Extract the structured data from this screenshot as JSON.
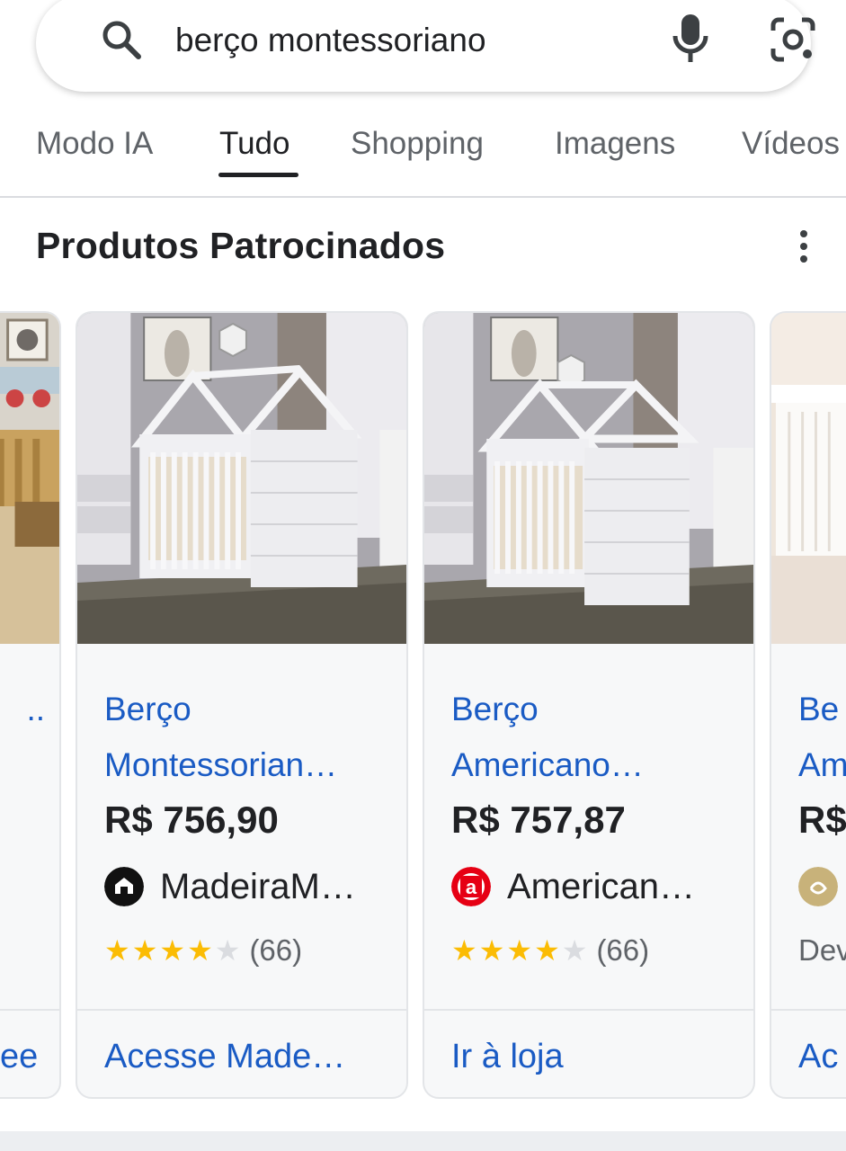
{
  "search": {
    "query": "berço montessoriano",
    "search_icon": "search-icon",
    "mic_icon": "mic-icon",
    "lens_icon": "lens-camera-icon"
  },
  "tabs": [
    {
      "label": "Modo IA",
      "active": false
    },
    {
      "label": "Tudo",
      "active": true
    },
    {
      "label": "Shopping",
      "active": false
    },
    {
      "label": "Imagens",
      "active": false
    },
    {
      "label": "Vídeos",
      "active": false
    }
  ],
  "section": {
    "title": "Produtos Patrocinados",
    "more_icon": "more-vert-icon"
  },
  "products": [
    {
      "title_line1": "",
      "title_line2": "..",
      "price": "",
      "seller": "",
      "rating_stars": 0,
      "rating_count": "",
      "cta": "ee"
    },
    {
      "title_line1": "Berço",
      "title_line2": "Montessorian…",
      "price": "R$ 756,90",
      "seller": "MadeiraM…",
      "seller_logo": "madeiramadeira-logo",
      "rating_stars": 4,
      "rating_count": "(66)",
      "cta": "Acesse Made…"
    },
    {
      "title_line1": "Berço",
      "title_line2": "Americano…",
      "price": "R$ 757,87",
      "seller": "American…",
      "seller_logo": "americanas-logo",
      "rating_stars": 4,
      "rating_count": "(66)",
      "cta": "Ir à loja"
    },
    {
      "title_line1": "Be",
      "title_line2": "Am",
      "price": "R$",
      "seller": "",
      "seller_logo": "gold-circle-logo",
      "rating_stars": 0,
      "rating_count": "Dev",
      "cta": "Ac"
    }
  ],
  "colors": {
    "link": "#1a5bc4",
    "star": "#fbbc04",
    "text": "#202124",
    "muted": "#5f6368"
  }
}
